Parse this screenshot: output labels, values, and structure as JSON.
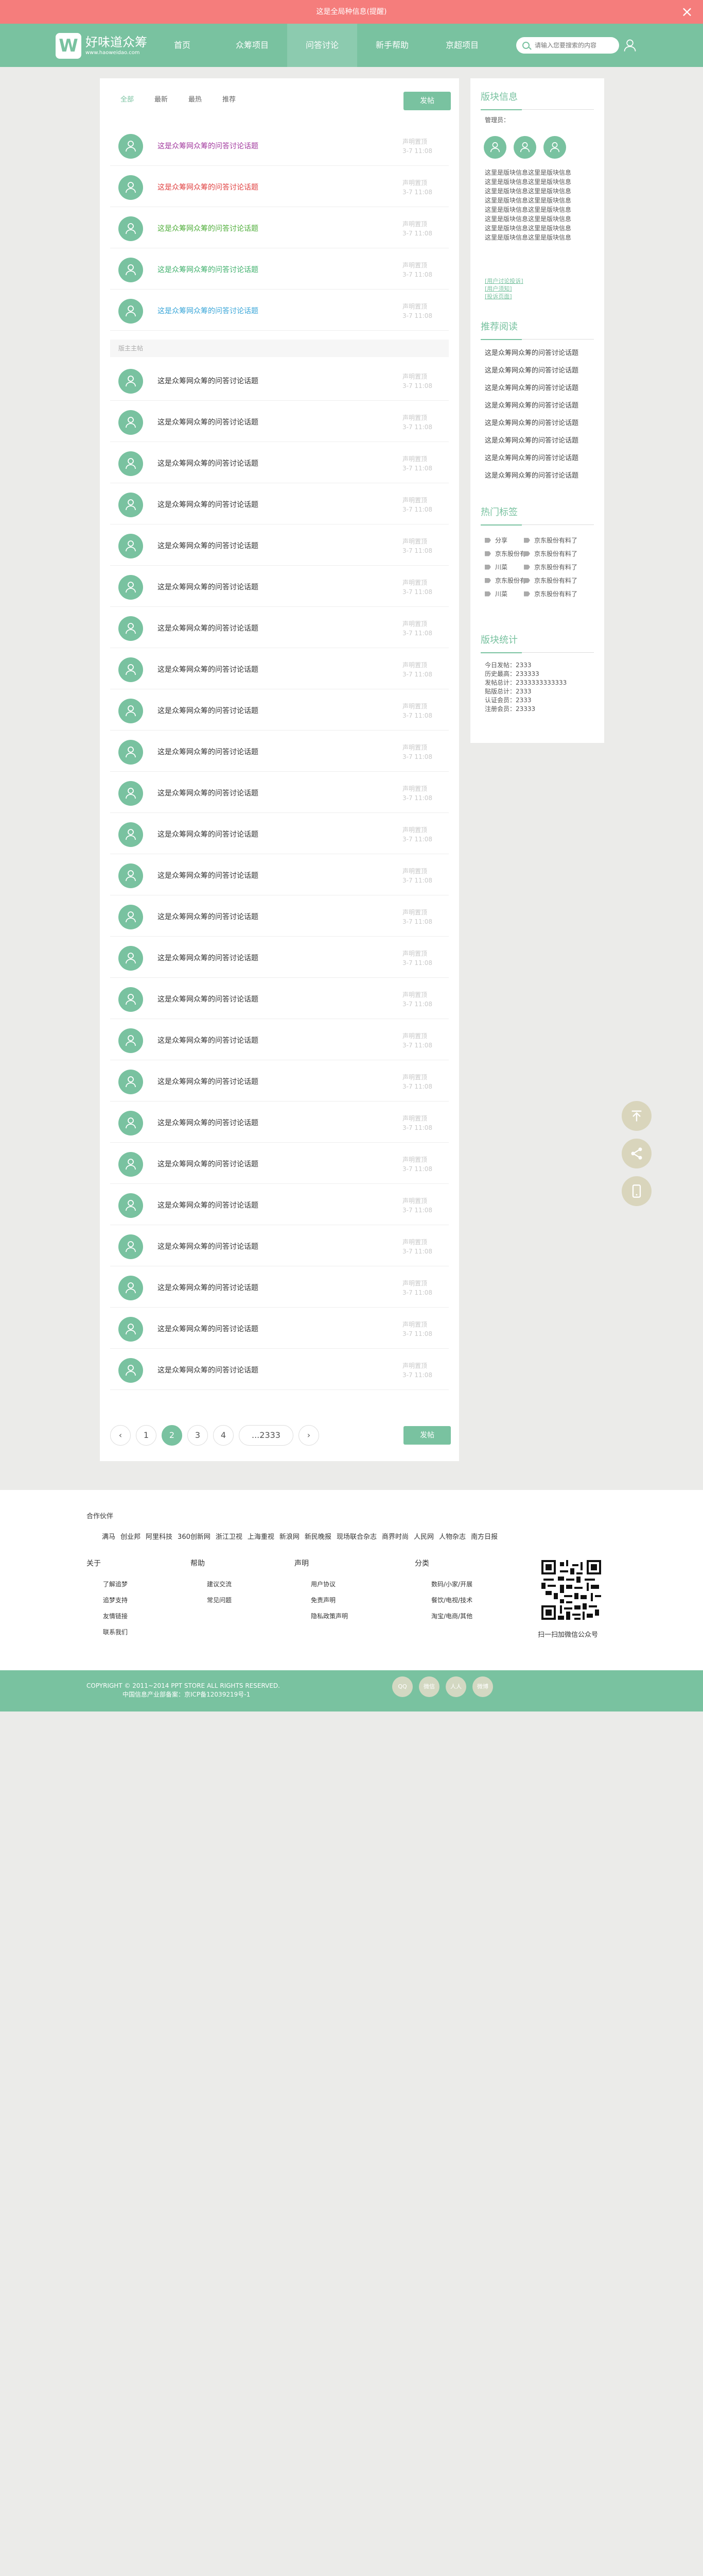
{
  "notice": {
    "text": "这是全局种信息(提醒)"
  },
  "header": {
    "logo_mark": "W",
    "logo_title": "好味道众筹",
    "logo_sub": "www.haoweidao.com",
    "nav": [
      "首页",
      "众筹项目",
      "问答讨论",
      "新手帮助",
      "京超项目"
    ],
    "active_nav": 2,
    "search_placeholder": "请输入您要搜索的内容"
  },
  "main": {
    "tabs": [
      "全部",
      "最新",
      "最热",
      "推荐"
    ],
    "post_button": "发帖",
    "section_label": "版主主帖",
    "pinned": [
      {
        "title": "这是众筹网众筹的问答讨论话题",
        "color": "#a23a9e",
        "author": "声明置顶",
        "date": "3-7 11:08"
      },
      {
        "title": "这是众筹网众筹的问答讨论话题",
        "color": "#e04040",
        "author": "声明置顶",
        "date": "3-7 11:08"
      },
      {
        "title": "这是众筹网众筹的问答讨论话题",
        "color": "#4fae3a",
        "author": "声明置顶",
        "date": "3-7 11:08"
      },
      {
        "title": "这是众筹网众筹的问答讨论话题",
        "color": "#3fb06c",
        "author": "声明置顶",
        "date": "3-7 11:08"
      },
      {
        "title": "这是众筹网众筹的问答讨论话题",
        "color": "#3aa6d8",
        "author": "声明置顶",
        "date": "3-7 11:08"
      }
    ],
    "topics": [
      {
        "title": "这是众筹网众筹的问答讨论话题",
        "author": "声明置顶",
        "date": "3-7 11:08"
      },
      {
        "title": "这是众筹网众筹的问答讨论话题",
        "author": "声明置顶",
        "date": "3-7 11:08"
      },
      {
        "title": "这是众筹网众筹的问答讨论话题",
        "author": "声明置顶",
        "date": "3-7 11:08"
      },
      {
        "title": "这是众筹网众筹的问答讨论话题",
        "author": "声明置顶",
        "date": "3-7 11:08"
      },
      {
        "title": "这是众筹网众筹的问答讨论话题",
        "author": "声明置顶",
        "date": "3-7 11:08"
      },
      {
        "title": "这是众筹网众筹的问答讨论话题",
        "author": "声明置顶",
        "date": "3-7 11:08"
      },
      {
        "title": "这是众筹网众筹的问答讨论话题",
        "author": "声明置顶",
        "date": "3-7 11:08"
      },
      {
        "title": "这是众筹网众筹的问答讨论话题",
        "author": "声明置顶",
        "date": "3-7 11:08"
      },
      {
        "title": "这是众筹网众筹的问答讨论话题",
        "author": "声明置顶",
        "date": "3-7 11:08"
      },
      {
        "title": "这是众筹网众筹的问答讨论话题",
        "author": "声明置顶",
        "date": "3-7 11:08"
      },
      {
        "title": "这是众筹网众筹的问答讨论话题",
        "author": "声明置顶",
        "date": "3-7 11:08"
      },
      {
        "title": "这是众筹网众筹的问答讨论话题",
        "author": "声明置顶",
        "date": "3-7 11:08"
      },
      {
        "title": "这是众筹网众筹的问答讨论话题",
        "author": "声明置顶",
        "date": "3-7 11:08"
      },
      {
        "title": "这是众筹网众筹的问答讨论话题",
        "author": "声明置顶",
        "date": "3-7 11:08"
      },
      {
        "title": "这是众筹网众筹的问答讨论话题",
        "author": "声明置顶",
        "date": "3-7 11:08"
      },
      {
        "title": "这是众筹网众筹的问答讨论话题",
        "author": "声明置顶",
        "date": "3-7 11:08"
      },
      {
        "title": "这是众筹网众筹的问答讨论话题",
        "author": "声明置顶",
        "date": "3-7 11:08"
      },
      {
        "title": "这是众筹网众筹的问答讨论话题",
        "author": "声明置顶",
        "date": "3-7 11:08"
      },
      {
        "title": "这是众筹网众筹的问答讨论话题",
        "author": "声明置顶",
        "date": "3-7 11:08"
      },
      {
        "title": "这是众筹网众筹的问答讨论话题",
        "author": "声明置顶",
        "date": "3-7 11:08"
      },
      {
        "title": "这是众筹网众筹的问答讨论话题",
        "author": "声明置顶",
        "date": "3-7 11:08"
      },
      {
        "title": "这是众筹网众筹的问答讨论话题",
        "author": "声明置顶",
        "date": "3-7 11:08"
      },
      {
        "title": "这是众筹网众筹的问答讨论话题",
        "author": "声明置顶",
        "date": "3-7 11:08"
      },
      {
        "title": "这是众筹网众筹的问答讨论话题",
        "author": "声明置顶",
        "date": "3-7 11:08"
      },
      {
        "title": "这是众筹网众筹的问答讨论话题",
        "author": "声明置顶",
        "date": "3-7 11:08"
      }
    ],
    "pagination": {
      "prev": "‹",
      "pages": [
        "1",
        "2",
        "3",
        "4",
        "...2333"
      ],
      "active": 1,
      "next": "›"
    }
  },
  "sidebar": {
    "info_title": "版块信息",
    "managers_label": "管理员：",
    "info_lines": [
      "这里是版块信息这里是版块信息",
      "这里是版块信息这里是版块信息",
      "这里是版块信息这里是版块信息",
      "这里是版块信息这里是版块信息",
      "这里是版块信息这里是版块信息",
      "这里是版块信息这里是版块信息",
      "这里是版块信息这里是版块信息",
      "这里是版块信息这里是版块信息"
    ],
    "links": [
      "[用户讨论投诉]",
      "[用户须知]",
      "[投诉页面]"
    ],
    "rec_title": "推荐阅读",
    "rec_items": [
      "这是众筹网众筹的问答讨论话题",
      "这是众筹网众筹的问答讨论话题",
      "这是众筹网众筹的问答讨论话题",
      "这是众筹网众筹的问答讨论话题",
      "这是众筹网众筹的问答讨论话题",
      "这是众筹网众筹的问答讨论话题",
      "这是众筹网众筹的问答讨论话题",
      "这是众筹网众筹的问答讨论话题"
    ],
    "tags_title": "热门标签",
    "tags": [
      "分享",
      "京东股份有料了",
      "京东股份有",
      "京东股份有料了",
      "川菜",
      "京东股份有料了",
      "京东股份有",
      "京东股份有料了",
      "川菜",
      "京东股份有料了"
    ],
    "stats_title": "版块统计",
    "stats": [
      "今日发帖：2333",
      "历史最高：233333",
      "发帖总计：2333333333333",
      "贴版总计：2333",
      "认证会员：2333",
      "注册会员：23333"
    ]
  },
  "floating": [
    "top-icon",
    "share-icon",
    "phone-icon"
  ],
  "footer": {
    "partners_title": "合作伙伴",
    "partners": [
      "满马",
      "创业邦",
      "阿里科技",
      "360创新网",
      "浙江卫视",
      "上海重视",
      "新浪网",
      "新民晚报",
      "现场联合杂志",
      "商界时尚",
      "人民网",
      "人物杂志",
      "南方日报"
    ],
    "columns": [
      {
        "title": "关于",
        "items": [
          "了解追梦",
          "追梦支持",
          "友情链接",
          "联系我们"
        ]
      },
      {
        "title": "帮助",
        "items": [
          "建议交流",
          "常见问题"
        ]
      },
      {
        "title": "声明",
        "items": [
          "用户协议",
          "免责声明",
          "隐私政策声明"
        ]
      },
      {
        "title": "分类",
        "items": [
          "数码/小家/开展",
          "餐饮/电视/技术",
          "淘宝/电商/其他"
        ]
      }
    ],
    "qr_caption": "扫一扫加微信公众号"
  },
  "bottom": {
    "copyright": "COPYRIGHT © 2011~2014 PPT STORE ALL RIGHTS RESERVED.",
    "icp": "中国信息产业部备案：京ICP备12039219号-1",
    "social": [
      "QQ",
      "微信",
      "人人",
      "微博"
    ]
  },
  "colors": {
    "accent": "#79c2a0",
    "notice": "#f57d7c",
    "float": "#d9d5bc"
  }
}
